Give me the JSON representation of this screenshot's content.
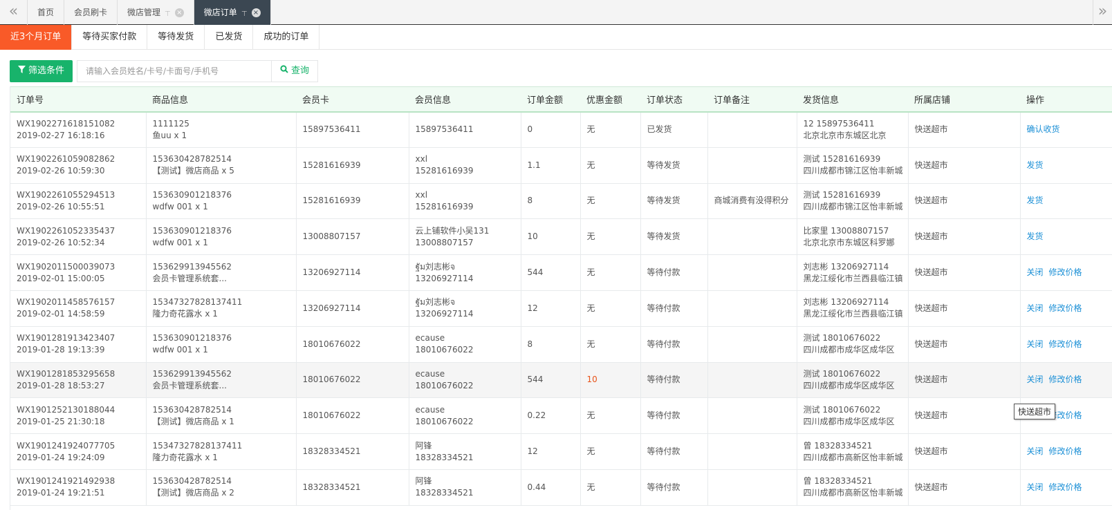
{
  "topbar": {
    "back_icon": "double-chevron-left-icon",
    "forward_icon": "double-chevron-right-icon",
    "tabs": [
      {
        "label": "首页",
        "pinned": false,
        "closable": false,
        "active": false
      },
      {
        "label": "会员刷卡",
        "pinned": false,
        "closable": false,
        "active": false
      },
      {
        "label": "微店管理",
        "pinned": true,
        "closable": true,
        "active": false
      },
      {
        "label": "微店订单",
        "pinned": true,
        "closable": true,
        "active": true
      }
    ]
  },
  "status_tabs": [
    {
      "label": "近3个月订单",
      "active": true
    },
    {
      "label": "等待买家付款",
      "active": false
    },
    {
      "label": "等待发货",
      "active": false
    },
    {
      "label": "已发货",
      "active": false
    },
    {
      "label": "成功的订单",
      "active": false
    }
  ],
  "filters": {
    "filter_button": "筛选条件",
    "search_placeholder": "请输入会员姓名/卡号/卡面号/手机号",
    "search_button": "查询"
  },
  "table": {
    "columns": [
      "订单号",
      "商品信息",
      "会员卡",
      "会员信息",
      "订单金额",
      "优惠金额",
      "订单状态",
      "订单备注",
      "发货信息",
      "所属店铺",
      "操作"
    ],
    "rows": [
      {
        "order_no": "WX1902271618151082",
        "time": "2019-02-27 16:18:16",
        "goods1": "1111125",
        "goods2": "鱼uu x 1",
        "card": "15897536411",
        "member1": "",
        "member2": "15897536411",
        "amount": "0",
        "discount": "无",
        "status": "已发货",
        "remark": "",
        "ship1": "12 15897536411",
        "ship2": "北京北京市东城区北京",
        "shop": "快送超市",
        "ops": [
          "确认收货"
        ]
      },
      {
        "order_no": "WX1902261059082862",
        "time": "2019-02-26 10:59:30",
        "goods1": "153630428782514",
        "goods2": "【测试】微店商品 x 5",
        "card": "15281616939",
        "member1": "xxl",
        "member2": "15281616939",
        "amount": "1.1",
        "discount": "无",
        "status": "等待发货",
        "remark": "",
        "ship1": "测试 15281616939",
        "ship2": "四川成都市锦江区怡丰新城",
        "shop": "快送超市",
        "ops": [
          "发货"
        ]
      },
      {
        "order_no": "WX1902261055294513",
        "time": "2019-02-26 10:55:51",
        "goods1": "153630901218376",
        "goods2": "wdfw 001 x 1",
        "card": "15281616939",
        "member1": "xxl",
        "member2": "15281616939",
        "amount": "8",
        "discount": "无",
        "status": "等待发货",
        "remark": "商城消费有没得积分",
        "ship1": "测试 15281616939",
        "ship2": "四川成都市锦江区怡丰新城",
        "shop": "快送超市",
        "ops": [
          "发货"
        ]
      },
      {
        "order_no": "WX1902261052335437",
        "time": "2019-02-26 10:52:34",
        "goods1": "153630901218376",
        "goods2": "wdfw 001 x 1",
        "card": "13008807157",
        "member1": "云上铺软件小吴131",
        "member2": "13008807157",
        "amount": "10",
        "discount": "无",
        "status": "等待发货",
        "remark": "",
        "ship1": "比家里 13008807157",
        "ship2": "北京北京市东城区科罗娜",
        "shop": "快送超市",
        "ops": [
          "发货"
        ]
      },
      {
        "order_no": "WX1902011500039073",
        "time": "2019-02-01 15:00:05",
        "goods1": "153629913945562",
        "goods2": "会员卡管理系统套...",
        "card": "13206927114",
        "member1": "ฐัม刘志彬จ",
        "member2": "13206927114",
        "amount": "544",
        "discount": "无",
        "status": "等待付款",
        "remark": "",
        "ship1": "刘志彬 13206927114",
        "ship2": "黑龙江绥化市兰西县临江镇",
        "shop": "快送超市",
        "ops": [
          "关闭",
          "修改价格"
        ]
      },
      {
        "order_no": "WX1902011458576157",
        "time": "2019-02-01 14:58:59",
        "goods1": "15347327828137411",
        "goods2": "隆力奇花露水 x 1",
        "card": "13206927114",
        "member1": "ฐัม刘志彬จ",
        "member2": "13206927114",
        "amount": "12",
        "discount": "无",
        "status": "等待付款",
        "remark": "",
        "ship1": "刘志彬 13206927114",
        "ship2": "黑龙江绥化市兰西县临江镇",
        "shop": "快送超市",
        "ops": [
          "关闭",
          "修改价格"
        ]
      },
      {
        "order_no": "WX1901281913423407",
        "time": "2019-01-28 19:13:39",
        "goods1": "153630901218376",
        "goods2": "wdfw 001 x 1",
        "card": "18010676022",
        "member1": "ecause",
        "member2": "18010676022",
        "amount": "8",
        "discount": "无",
        "status": "等待付款",
        "remark": "",
        "ship1": "测试 18010676022",
        "ship2": "四川成都市成华区成华区",
        "shop": "快送超市",
        "ops": [
          "关闭",
          "修改价格"
        ]
      },
      {
        "order_no": "WX1901281853295658",
        "time": "2019-01-28 18:53:27",
        "goods1": "153629913945562",
        "goods2": "会员卡管理系统套...",
        "card": "18010676022",
        "member1": "ecause",
        "member2": "18010676022",
        "amount": "544",
        "discount": "10",
        "status": "等待付款",
        "remark": "",
        "ship1": "测试 18010676022",
        "ship2": "四川成都市成华区成华区",
        "shop": "快送超市",
        "ops": [
          "关闭",
          "修改价格"
        ]
      },
      {
        "order_no": "WX1901252130188044",
        "time": "2019-01-25 21:30:18",
        "goods1": "153630428782514",
        "goods2": "【测试】微店商品 x 1",
        "card": "18010676022",
        "member1": "ecause",
        "member2": "18010676022",
        "amount": "0.22",
        "discount": "无",
        "status": "等待付款",
        "remark": "",
        "ship1": "测试 18010676022",
        "ship2": "四川成都市成华区成华区",
        "shop": "快送超市",
        "ops": [
          "关闭",
          "修改价格"
        ]
      },
      {
        "order_no": "WX1901241924077705",
        "time": "2019-01-24 19:24:09",
        "goods1": "15347327828137411",
        "goods2": "隆力奇花露水 x 1",
        "card": "18328334521",
        "member1": "阿锋",
        "member2": "18328334521",
        "amount": "12",
        "discount": "无",
        "status": "等待付款",
        "remark": "",
        "ship1": "曾 18328334521",
        "ship2": "四川成都市高新区怡丰新城",
        "shop": "快送超市",
        "ops": [
          "关闭",
          "修改价格"
        ]
      },
      {
        "order_no": "WX1901241921492938",
        "time": "2019-01-24 19:21:51",
        "goods1": "153630428782514",
        "goods2": "【测试】微店商品 x 2",
        "card": "18328334521",
        "member1": "阿锋",
        "member2": "18328334521",
        "amount": "0.44",
        "discount": "无",
        "status": "等待付款",
        "remark": "",
        "ship1": "曾 18328334521",
        "ship2": "四川成都市高新区怡丰新城",
        "shop": "快送超市",
        "ops": [
          "关闭",
          "修改价格"
        ]
      }
    ],
    "highlight_row": 7
  },
  "tooltip": "快送超市",
  "colors": {
    "accent_orange": "#f95a28",
    "green": "#18b36b",
    "link": "#1a8fd6",
    "discount_red": "#e8541a"
  }
}
